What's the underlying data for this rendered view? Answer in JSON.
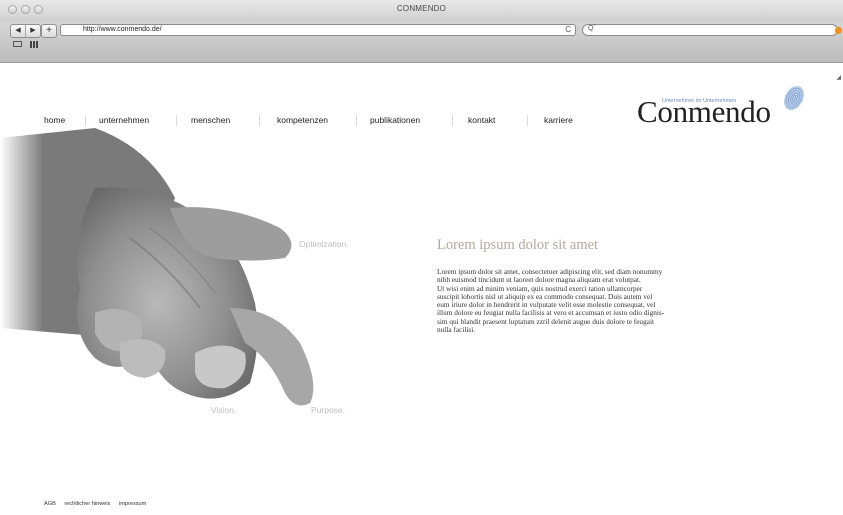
{
  "window": {
    "title": "CONMENDO"
  },
  "toolbar": {
    "back_label": "◀",
    "forward_label": "▶",
    "add_label": "+",
    "url": "http://www.conmendo.de/",
    "reload_label": "C",
    "search_label": "Qˇ"
  },
  "nav": {
    "items": [
      {
        "label": "home"
      },
      {
        "label": "unternehmen"
      },
      {
        "label": "menschen"
      },
      {
        "label": "kompetenzen"
      },
      {
        "label": "publikationen"
      },
      {
        "label": "kontakt"
      },
      {
        "label": "karriere"
      }
    ]
  },
  "logo": {
    "text": "Conmendo",
    "tagline": "Unternehmer im Unternehmen",
    "accent": "#6a8ec0"
  },
  "hero": {
    "words": [
      "Optimization.",
      "Vision.",
      "Purpose."
    ],
    "word_color": "#bdbdbd"
  },
  "content": {
    "headline": "Lorem ipsum dolor sit amet",
    "headline_color": "#b5a99b",
    "body_lines": [
      "Lorem ipsum dolor sit amet, consectetuer adipiscing elit, sed diam nonummy",
      "nibh euismod tincidunt ut laoreet dolore magna aliquam erat volutpat.",
      "Ut wisi enim ad minim veniam, quis nostrud exerci tation ullamcorper",
      "suscipit lobortis nisl ut aliquip ex ea commodo consequat. Duis autem vel",
      "eum iriure dolor in hendrerit in vulputate velit esse molestie consequat, vel",
      "illum dolore eu feugiat nulla facilisis at vero et accumsan et iusto odio dignis-",
      "sim qui blandit praesent luptatum zzril delenit augue duis dolore te feugait",
      "nulla facilisi."
    ]
  },
  "footer": {
    "links": [
      "AGB",
      "rechtlicher hinweis",
      "impressum"
    ]
  }
}
